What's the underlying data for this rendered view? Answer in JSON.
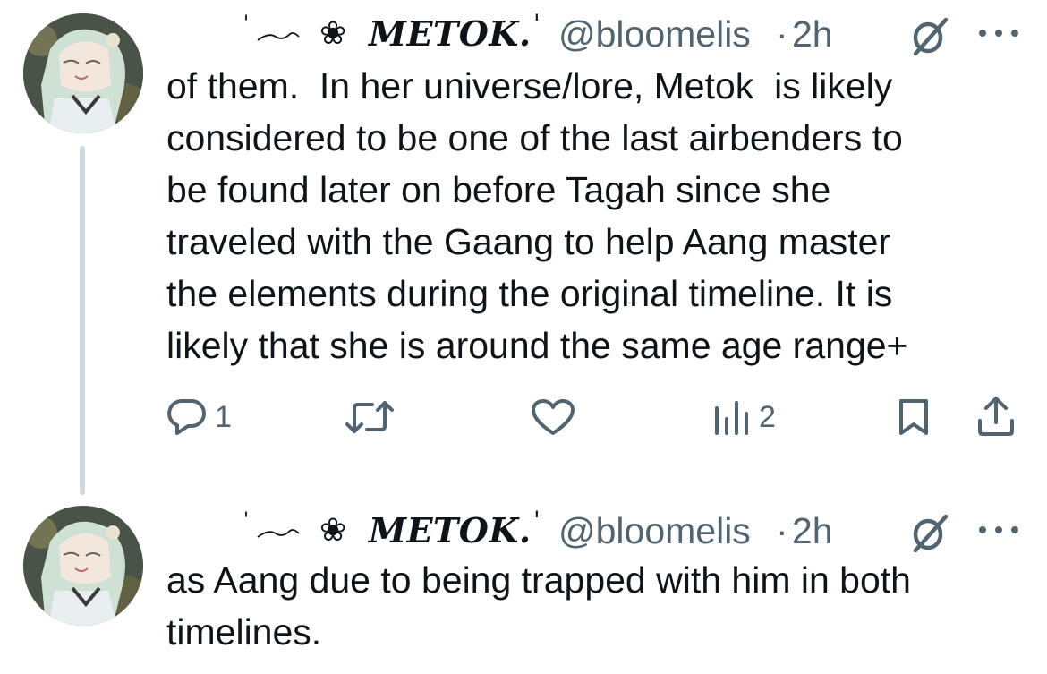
{
  "tweets": [
    {
      "author": {
        "tick": "'",
        "flower": "❀",
        "name": "METOK.",
        "name_tick": "'",
        "handle": "@bloomelis",
        "separator": "·",
        "time": "2h"
      },
      "text_lines": [
        "of them.  In her universe/lore, Metok  is likely",
        "considered to be one of the last airbenders to",
        "be found later on before Tagah since she",
        "traveled with the Gaang to help Aang master",
        "the elements during the original timeline. It is",
        "likely that she is around the same age range+"
      ],
      "actions": {
        "reply_count": "1",
        "repost_count": "",
        "like_count": "",
        "views_count": "2"
      }
    },
    {
      "author": {
        "tick": "'",
        "flower": "❀",
        "name": "METOK.",
        "name_tick": "'",
        "handle": "@bloomelis",
        "separator": "·",
        "time": "2h"
      },
      "text_lines": [
        "as Aang due to being trapped with him in both",
        "timelines."
      ]
    }
  ],
  "icons": {
    "reply": "reply-icon",
    "repost": "repost-icon",
    "like": "heart-icon",
    "views": "views-icon",
    "bookmark": "bookmark-icon",
    "share": "share-icon",
    "subscribe": "circle-slash-icon",
    "more": "more-icon"
  },
  "colors": {
    "text": "#0f1419",
    "secondary": "#536471",
    "thread_line": "#cfd9de"
  }
}
